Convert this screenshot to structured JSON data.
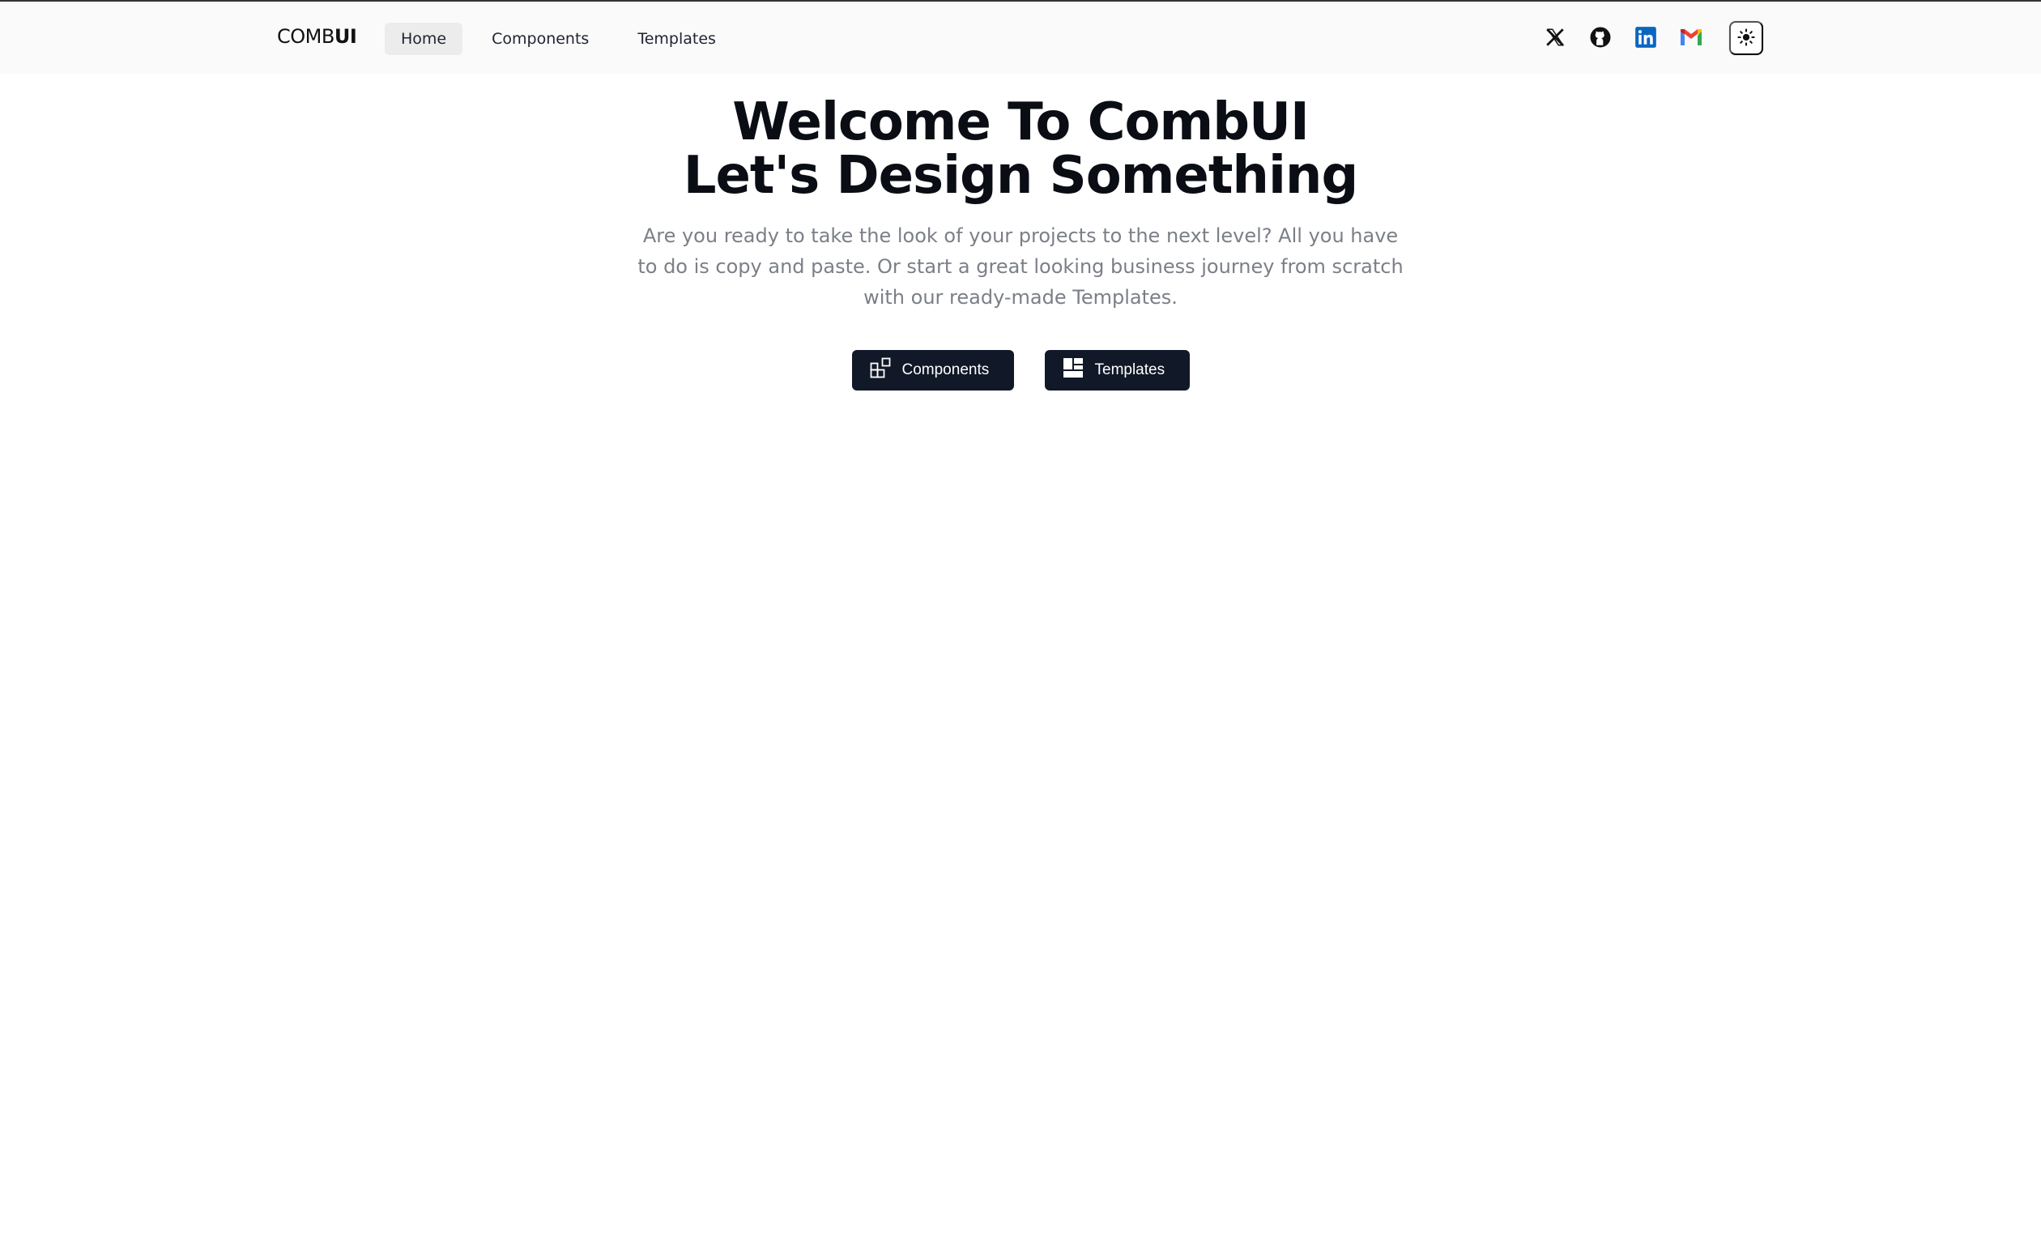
{
  "brand": {
    "part1": "COMB",
    "part2": "UI"
  },
  "nav": [
    {
      "label": "Home",
      "active": true
    },
    {
      "label": "Components",
      "active": false
    },
    {
      "label": "Templates",
      "active": false
    }
  ],
  "social_icons": [
    "x-icon",
    "github-icon",
    "linkedin-icon",
    "gmail-icon"
  ],
  "theme_toggle_icon": "sun-icon",
  "hero": {
    "title": "Welcome To CombUI Let's Design Something",
    "subtitle": "Are you ready to take the look of your projects to the next level? All you have to do is copy and paste. Or start a great looking business journey from scratch with our ready-made Templates."
  },
  "cta": {
    "components_label": "Components",
    "templates_label": "Templates"
  },
  "colors": {
    "button_bg": "#111827",
    "header_bg": "#fafafa",
    "subtitle": "#7b7f87",
    "linkedin": "#0a66c2"
  }
}
